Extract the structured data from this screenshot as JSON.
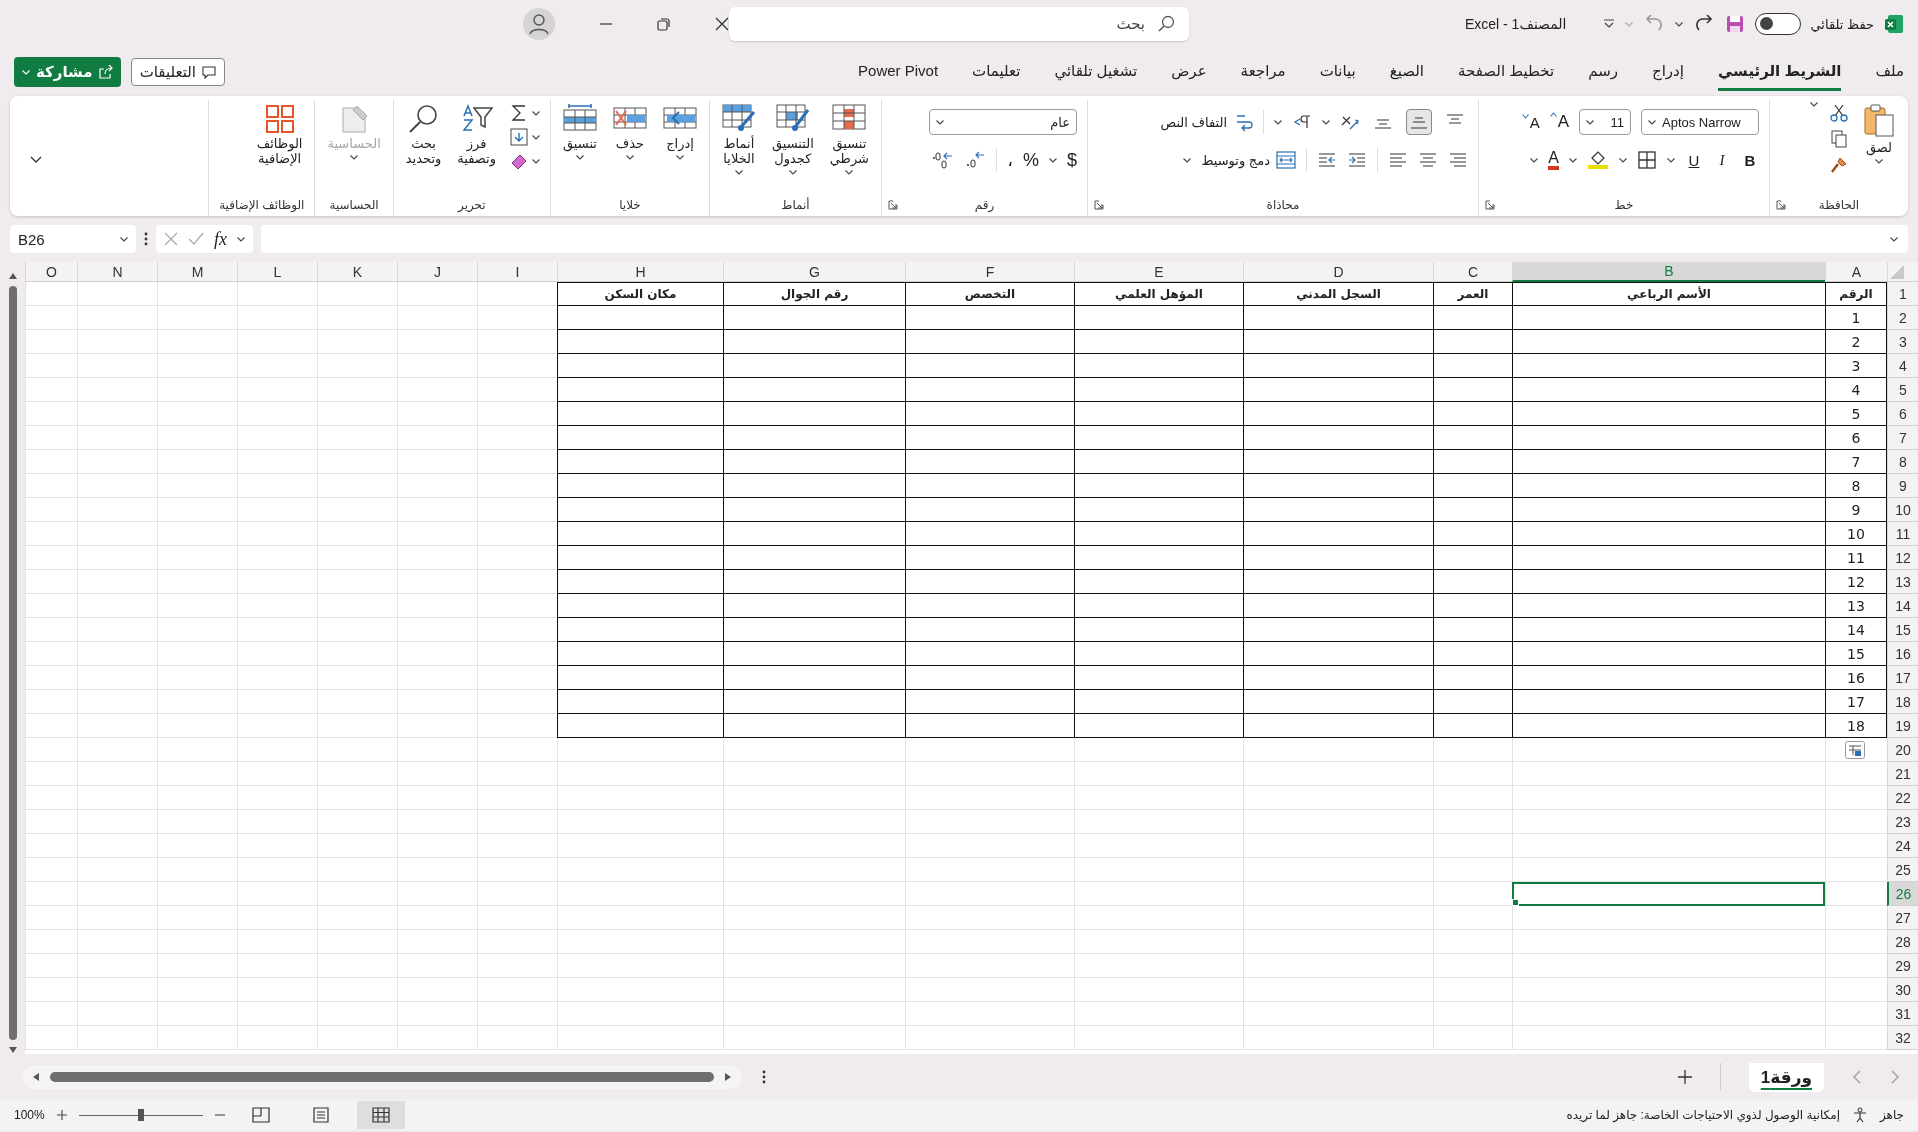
{
  "title_bar": {
    "autosave_label": "حفظ تلقائي",
    "autosave_on": false,
    "title": "المصنف1 - Excel",
    "search_placeholder": "بحث"
  },
  "tabs": [
    {
      "label": "ملف",
      "selected": false
    },
    {
      "label": "الشريط الرئيسي",
      "selected": true
    },
    {
      "label": "إدراج",
      "selected": false
    },
    {
      "label": "رسم",
      "selected": false
    },
    {
      "label": "تخطيط الصفحة",
      "selected": false
    },
    {
      "label": "الصيغ",
      "selected": false
    },
    {
      "label": "بيانات",
      "selected": false
    },
    {
      "label": "مراجعة",
      "selected": false
    },
    {
      "label": "عرض",
      "selected": false
    },
    {
      "label": "تشغيل تلقائي",
      "selected": false
    },
    {
      "label": "تعليمات",
      "selected": false
    },
    {
      "label": "Power Pivot",
      "selected": false
    }
  ],
  "comments_button": "التعليقات",
  "share_button": "مشاركة",
  "ribbon": {
    "groups": [
      {
        "kind": "clipboard",
        "title": "الحافظة",
        "dialog_launcher": true,
        "paste": "لصق"
      },
      {
        "kind": "font",
        "title": "خط",
        "dialog_launcher": true,
        "font": "Aptos Narrow",
        "size": "11",
        "grow": "A",
        "shrink": "A",
        "styles": [
          "B",
          "I",
          "U"
        ],
        "color_letter": "A"
      },
      {
        "kind": "alignment",
        "title": "محاذاة",
        "dialog_launcher": true,
        "vertical_alignment": [
          {
            "selected": false
          },
          {
            "selected": true
          },
          {
            "selected": false
          }
        ],
        "wrap": "التفاف النص",
        "merge": "دمج وتوسيط"
      },
      {
        "kind": "number",
        "title": "رقم",
        "dialog_launcher": true,
        "format": "عام",
        "symbols": [
          "$",
          "%",
          "،"
        ]
      },
      {
        "kind": "large_buttons",
        "title": "أنماط",
        "dialog_launcher": false,
        "buttons": [
          {
            "label": "تنسيق\nشرطي",
            "kind": "conditional",
            "disabled": false
          },
          {
            "label": "التنسيق\nكجدول",
            "kind": "table",
            "disabled": false
          },
          {
            "label": "أنماط\nالخلايا",
            "kind": "styles",
            "disabled": false
          }
        ]
      },
      {
        "kind": "large_buttons",
        "title": "خلايا",
        "dialog_launcher": false,
        "buttons": [
          {
            "label": "إدراج",
            "kind": "insert",
            "disabled": false
          },
          {
            "label": "حذف",
            "kind": "delete",
            "disabled": false
          },
          {
            "label": "تنسيق",
            "kind": "format",
            "disabled": false
          }
        ]
      },
      {
        "kind": "editing",
        "title": "تحرير",
        "dialog_launcher": false,
        "buttons": [
          {
            "label": "فرز\nوتصفية",
            "kind": "sort"
          },
          {
            "label": "بحث\nوتحديد",
            "kind": "find"
          }
        ]
      },
      {
        "kind": "large_buttons",
        "title": "الحساسية",
        "dialog_launcher": false,
        "buttons": [
          {
            "label": "الحساسية",
            "kind": "sensitivity",
            "disabled": true
          }
        ]
      },
      {
        "kind": "large_buttons",
        "title": "الوظائف الإضافية",
        "dialog_launcher": false,
        "buttons": [
          {
            "label": "الوظائف\nالإضافية",
            "kind": "addins",
            "disabled": false
          }
        ]
      }
    ]
  },
  "formula_bar": {
    "name_box": "B26",
    "function_label": "fx"
  },
  "sheet": {
    "columns": [
      {
        "label": "A",
        "selected": false
      },
      {
        "label": "B",
        "selected": true
      },
      {
        "label": "C",
        "selected": false
      },
      {
        "label": "D",
        "selected": false
      },
      {
        "label": "E",
        "selected": false
      },
      {
        "label": "F",
        "selected": false
      },
      {
        "label": "G",
        "selected": false
      },
      {
        "label": "H",
        "selected": false
      },
      {
        "label": "I",
        "selected": false
      },
      {
        "label": "J",
        "selected": false
      },
      {
        "label": "K",
        "selected": false
      },
      {
        "label": "L",
        "selected": false
      },
      {
        "label": "M",
        "selected": false
      },
      {
        "label": "N",
        "selected": false
      },
      {
        "label": "O",
        "selected": false
      }
    ],
    "rows": [
      {
        "label": "1",
        "selected": false
      },
      {
        "label": "2",
        "selected": false
      },
      {
        "label": "3",
        "selected": false
      },
      {
        "label": "4",
        "selected": false
      },
      {
        "label": "5",
        "selected": false
      },
      {
        "label": "6",
        "selected": false
      },
      {
        "label": "7",
        "selected": false
      },
      {
        "label": "8",
        "selected": false
      },
      {
        "label": "9",
        "selected": false
      },
      {
        "label": "10",
        "selected": false
      },
      {
        "label": "11",
        "selected": false
      },
      {
        "label": "12",
        "selected": false
      },
      {
        "label": "13",
        "selected": false
      },
      {
        "label": "14",
        "selected": false
      },
      {
        "label": "15",
        "selected": false
      },
      {
        "label": "16",
        "selected": false
      },
      {
        "label": "17",
        "selected": false
      },
      {
        "label": "18",
        "selected": false
      },
      {
        "label": "19",
        "selected": false
      },
      {
        "label": "20",
        "selected": false
      },
      {
        "label": "21",
        "selected": false
      },
      {
        "label": "22",
        "selected": false
      },
      {
        "label": "23",
        "selected": false
      },
      {
        "label": "24",
        "selected": false
      },
      {
        "label": "25",
        "selected": false
      },
      {
        "label": "26",
        "selected": true
      },
      {
        "label": "27",
        "selected": false
      },
      {
        "label": "28",
        "selected": false
      },
      {
        "label": "29",
        "selected": false
      },
      {
        "label": "30",
        "selected": false
      },
      {
        "label": "31",
        "selected": false
      },
      {
        "label": "32",
        "selected": false
      }
    ]
  },
  "table": {
    "columns": [
      "الرقم",
      "الأسم الرباعي",
      "العمر",
      "السجل المدني",
      "المؤهل العلمي",
      "التخصص",
      "رقم الجوال",
      "مكان السكن"
    ],
    "rows": [
      {
        "serial": "1"
      },
      {
        "serial": "2"
      },
      {
        "serial": "3"
      },
      {
        "serial": "4"
      },
      {
        "serial": "5"
      },
      {
        "serial": "6"
      },
      {
        "serial": "7"
      },
      {
        "serial": "8"
      },
      {
        "serial": "9"
      },
      {
        "serial": "10"
      },
      {
        "serial": "11"
      },
      {
        "serial": "12"
      },
      {
        "serial": "13"
      },
      {
        "serial": "14"
      },
      {
        "serial": "15"
      },
      {
        "serial": "16"
      },
      {
        "serial": "17"
      },
      {
        "serial": "18"
      }
    ]
  },
  "sheet_tabs": [
    {
      "label": "ورقة1",
      "selected": true
    }
  ],
  "status_bar": {
    "ready": "جاهز",
    "accessibility": "إمكانية الوصول لذوي الاحتياجات الخاصة: جاهز لما تريده",
    "zoom": "100%",
    "zoom_slider": {
      "level": 0.5
    },
    "views": [
      {
        "selected": false
      },
      {
        "selected": false
      },
      {
        "selected": true
      }
    ]
  }
}
